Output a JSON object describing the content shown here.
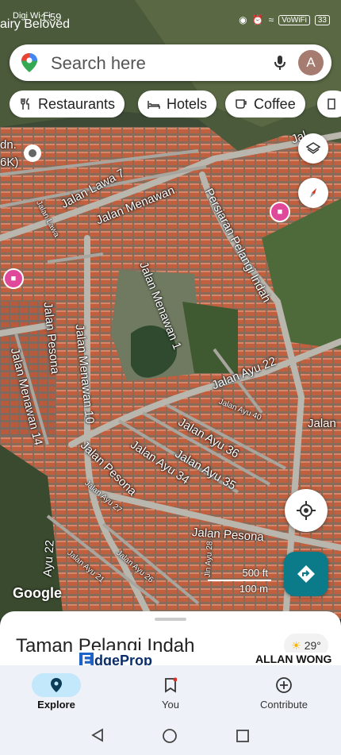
{
  "status_bar": {
    "carrier": "Digi Wi-Fi",
    "partial_time": "1:59",
    "battery": "33",
    "wifi_badge": "VoWiFi",
    "partial_place": "airy Beloved"
  },
  "search": {
    "placeholder": "Search here",
    "avatar_letter": "A"
  },
  "chips": [
    {
      "label": "Restaurants",
      "icon": "fork-knife-icon"
    },
    {
      "label": "Hotels",
      "icon": "bed-icon"
    },
    {
      "label": "Coffee",
      "icon": "coffee-cup-icon"
    }
  ],
  "map": {
    "labels": {
      "lawa7": "Jalan Lawa 7",
      "lawa_small": "Jalan Lawa",
      "menawan": "Jalan Menawan",
      "persiaran": "Persiaran Pelangi Indah",
      "menawan1": "Jalan Menawan 1",
      "pesona_v": "Jalan Pesona",
      "menawan10": "Jalan Menawan 10",
      "menawan14": "Jalan Menawan 14",
      "ayu22": "Jalan Ayu 22",
      "ayu40": "Jalan Ayu 40",
      "ayu36": "Jalan Ayu 36",
      "ayu35": "Jalan Ayu 35",
      "ayu34": "Jalan Ayu 34",
      "pesona_d": "Jalan Pesona",
      "pesona_h": "Jalan Pesona",
      "ayu27": "Jalan Ayu 27",
      "ayu21": "Jalan Ayu 21",
      "ayu26": "Jalan Ayu 26",
      "ayu28": "Jln Ayu 28",
      "ayu_partial": "Ayu 22",
      "jalan_right": "Jalan",
      "left_partial": "dn.",
      "left_partial2": "6K)",
      "jal_top": "Jal"
    },
    "google_label": "Google",
    "scale_ft": "500 ft",
    "scale_m": "100 m"
  },
  "sheet": {
    "place_name": "Taman Pelangi Indah",
    "weather": "29°"
  },
  "watermark": {
    "brand_e": "E",
    "brand_rest": "dgeProp",
    "agent": "ALLAN WONG"
  },
  "bottom_nav": [
    {
      "label": "Explore",
      "active": true
    },
    {
      "label": "You",
      "active": false
    },
    {
      "label": "Contribute",
      "active": false
    }
  ],
  "colors": {
    "accent": "#0b7b8a",
    "nav_active": "#c3e7fb",
    "hotel_pin": "#e0489a"
  }
}
